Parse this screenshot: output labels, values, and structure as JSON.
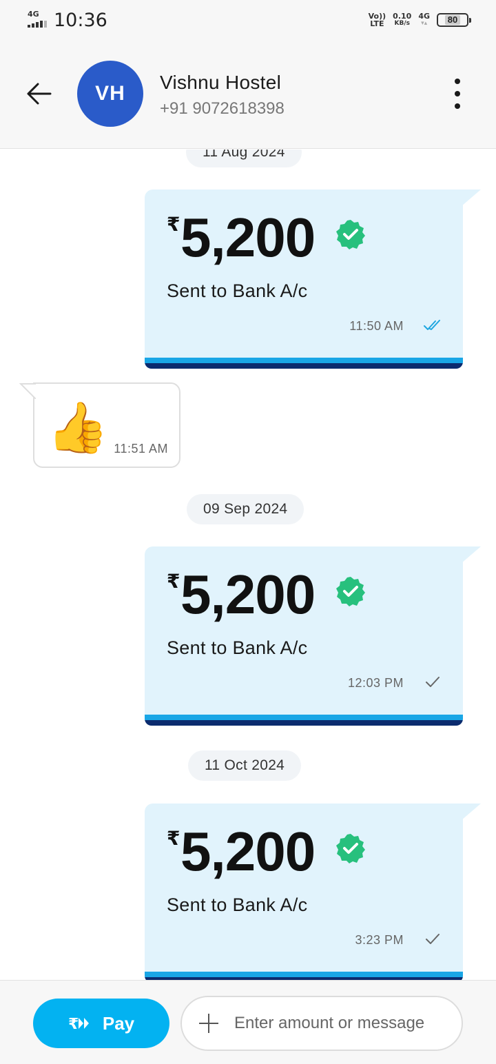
{
  "status_bar": {
    "network_type": "4G",
    "time": "10:36",
    "volte_top": "Vo))",
    "volte_bottom": "LTE",
    "speed_value": "0.10",
    "speed_unit": "KB/s",
    "net_label": "4G",
    "battery": "80"
  },
  "header": {
    "avatar_initials": "VH",
    "avatar_color": "#2a5bc9",
    "contact_name": "Vishnu Hostel",
    "contact_phone": "+91 9072618398",
    "back_icon": "arrow-left-icon",
    "menu_icon": "more-vertical-icon"
  },
  "messages": [
    {
      "type": "date",
      "label": "11 Aug 2024"
    },
    {
      "type": "payment",
      "currency": "₹",
      "amount": "5,200",
      "description": "Sent to Bank A/c",
      "time": "11:50 AM",
      "status": "read"
    },
    {
      "type": "received",
      "emoji": "👍",
      "time": "11:51 AM"
    },
    {
      "type": "date",
      "label": "09 Sep 2024"
    },
    {
      "type": "payment",
      "currency": "₹",
      "amount": "5,200",
      "description": "Sent to Bank A/c",
      "time": "12:03 PM",
      "status": "sent"
    },
    {
      "type": "date",
      "label": "11 Oct 2024"
    },
    {
      "type": "payment",
      "currency": "₹",
      "amount": "5,200",
      "description": "Sent to Bank A/c",
      "time": "3:23 PM",
      "status": "sent"
    }
  ],
  "bottom_bar": {
    "pay_label": "Pay",
    "pay_icon": "rupee-pay-icon",
    "input_placeholder": "Enter amount or message",
    "input_value": ""
  },
  "colors": {
    "accent": "#03b2f1",
    "card_bg": "#e1f3fc",
    "verified_green": "#27c07d",
    "stripe_light": "#19a6e6",
    "stripe_dark": "#0b2b6e"
  }
}
